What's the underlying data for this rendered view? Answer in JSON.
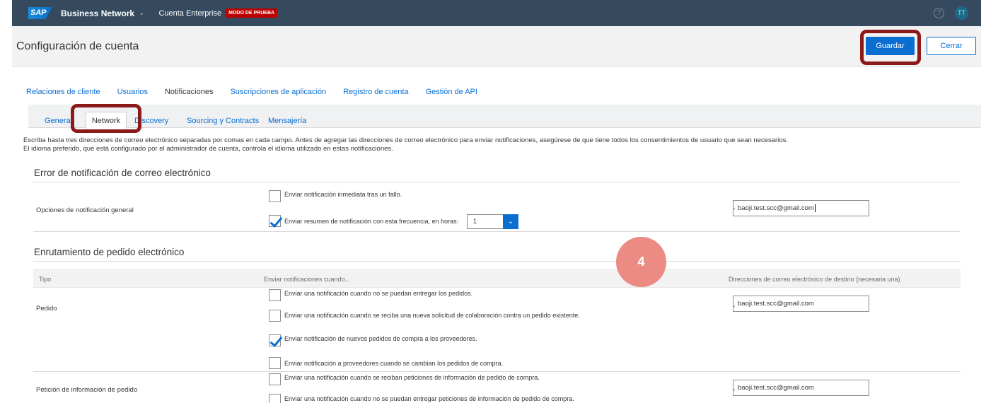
{
  "shell": {
    "logo": "SAP",
    "product": "Business Network",
    "account": "Cuenta Enterprise",
    "mode_badge": "MODO DE PRUEBA",
    "help_icon": "question-circle-icon",
    "avatar": "TT"
  },
  "header": {
    "title": "Configuración de cuenta",
    "save": "Guardar",
    "close": "Cerrar"
  },
  "tabs": [
    "Relaciones de cliente",
    "Usuarios",
    "Notificaciones",
    "Suscripciones de aplicación",
    "Registro de cuenta",
    "Gestión de API"
  ],
  "active_tab": "Notificaciones",
  "subtabs": [
    "General",
    "Network",
    "Discovery",
    "Sourcing y Contracts",
    "Mensajería"
  ],
  "active_subtab": "Network",
  "intro": [
    "Escriba hasta tres direcciones de correo electrónico separadas por comas en cada campo. Antes de agregar las direcciones de correo electrónico para enviar notificaciones, asegúrese de que tiene todos los consentimientos de usuario que sean necesarios.",
    "El idioma preferido, que está configurado por el administrador de cuenta, controla el idioma utilizado en estas notificaciones."
  ],
  "section1": {
    "title": "Error de notificación de correo electrónico",
    "row_label": "Opciones de notificación general",
    "opt1": "Enviar notificación inmediata tras un fallo.",
    "opt1_checked": false,
    "opt2": "Enviar resumen de notificación con esta frecuencia, en horas:",
    "opt2_checked": true,
    "hours": "1",
    "email": "baoji.test.scc@gmail.com"
  },
  "section2": {
    "title": "Enrutamiento de pedido electrónico",
    "col_tipo": "Tipo",
    "col_enviar": "Enviar notificaciones cuando...",
    "col_dir": "Direcciones de correo electrónico de destino (necesaria una)",
    "pedido": {
      "label": "Pedido",
      "opts": [
        {
          "text": "Enviar una notificación cuando no se puedan entregar los pedidos.",
          "checked": false
        },
        {
          "text": "Enviar una notificación cuando se reciba una nueva solicitud de colaboración contra un pedido existente.",
          "checked": false
        },
        {
          "text": "Enviar notificación de nuevos pedidos de compra a los proveedores.",
          "checked": true
        },
        {
          "text": "Enviar notificación a proveedores cuando se cambian los pedidos de compra.",
          "checked": false
        }
      ],
      "email": "baoji.test.scc@gmail.com"
    },
    "peticion": {
      "label": "Petición de información de pedido",
      "opts": [
        {
          "text": "Enviar una notificación cuando se reciban peticiones de información de pedido de compra.",
          "checked": false
        },
        {
          "text": "Enviar una notificación cuando no se puedan entregar peticiones de información de pedido de compra.",
          "checked": false
        }
      ],
      "email": "baoji.test.scc@gmail.com"
    }
  },
  "step_badge": "4",
  "colors": {
    "shell": "#354a5f",
    "accent": "#0a6ed1",
    "highlight": "#8b1a1a",
    "badge": "#ec8a84"
  }
}
